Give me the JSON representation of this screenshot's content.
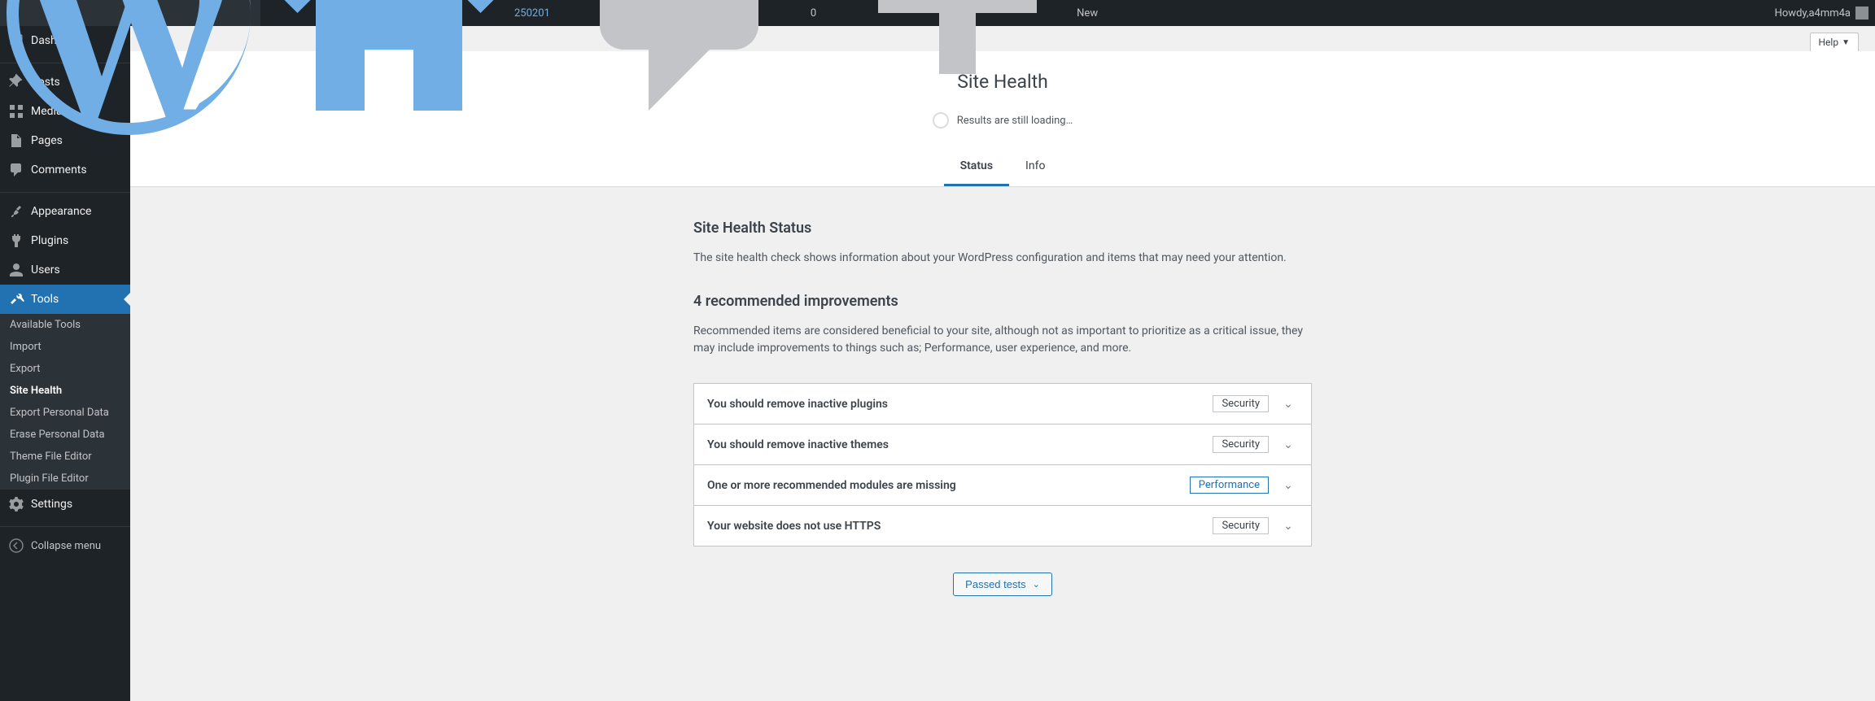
{
  "adminbar": {
    "site_name": "250201",
    "comments_count": "0",
    "new_label": "New",
    "howdy_prefix": "Howdy, ",
    "username": "a4mm4a"
  },
  "sidebar": {
    "items": [
      {
        "label": "Dashboard"
      },
      {
        "label": "Posts"
      },
      {
        "label": "Media"
      },
      {
        "label": "Pages"
      },
      {
        "label": "Comments"
      },
      {
        "label": "Appearance"
      },
      {
        "label": "Plugins"
      },
      {
        "label": "Users"
      },
      {
        "label": "Tools"
      },
      {
        "label": "Settings"
      }
    ],
    "submenu": [
      {
        "label": "Available Tools"
      },
      {
        "label": "Import"
      },
      {
        "label": "Export"
      },
      {
        "label": "Site Health"
      },
      {
        "label": "Export Personal Data"
      },
      {
        "label": "Erase Personal Data"
      },
      {
        "label": "Theme File Editor"
      },
      {
        "label": "Plugin File Editor"
      }
    ],
    "collapse_label": "Collapse menu"
  },
  "header": {
    "help_label": "Help",
    "page_title": "Site Health",
    "loading_text": "Results are still loading…",
    "tabs": [
      {
        "label": "Status"
      },
      {
        "label": "Info"
      }
    ]
  },
  "body": {
    "status_title": "Site Health Status",
    "status_desc": "The site health check shows information about your WordPress configuration and items that may need your attention.",
    "recommended_title": "4 recommended improvements",
    "recommended_desc": "Recommended items are considered beneficial to your site, although not as important to prioritize as a critical issue, they may include improvements to things such as; Performance, user experience, and more.",
    "issues": [
      {
        "title": "You should remove inactive plugins",
        "badge": "Security",
        "badge_type": "security"
      },
      {
        "title": "You should remove inactive themes",
        "badge": "Security",
        "badge_type": "security"
      },
      {
        "title": "One or more recommended modules are missing",
        "badge": "Performance",
        "badge_type": "performance"
      },
      {
        "title": "Your website does not use HTTPS",
        "badge": "Security",
        "badge_type": "security"
      }
    ],
    "passed_label": "Passed tests"
  }
}
